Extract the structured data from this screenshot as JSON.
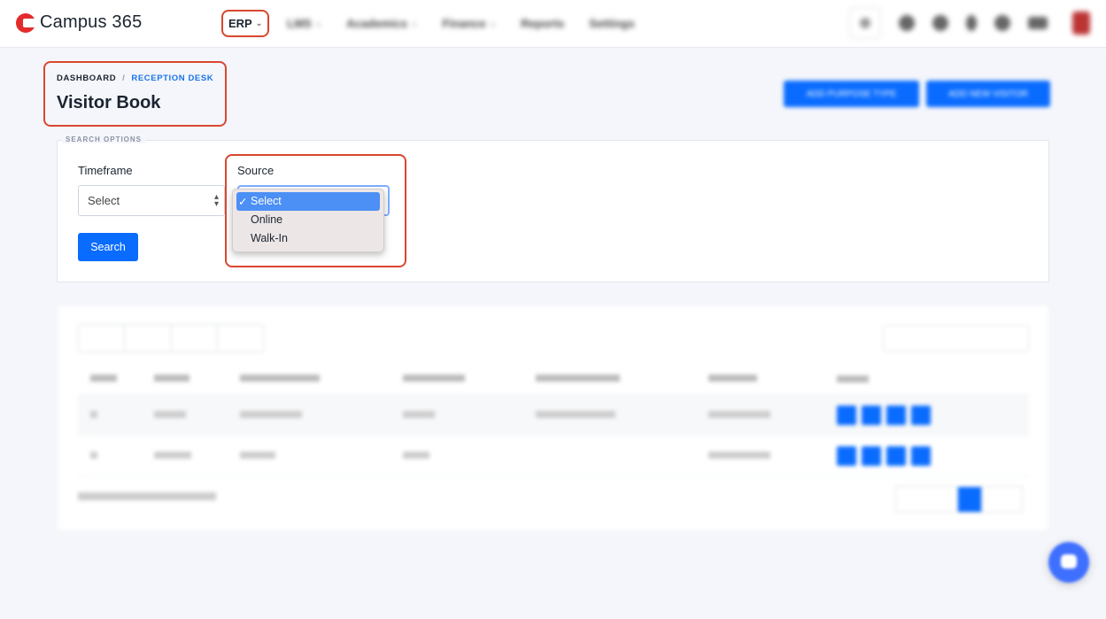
{
  "app": {
    "name": "Campus 365"
  },
  "nav": {
    "erp_label": "ERP",
    "menu": [
      "LMS",
      "Academics",
      "Finance",
      "Reports",
      "Settings"
    ]
  },
  "breadcrumb": {
    "home": "DASHBOARD",
    "separator": "/",
    "current": "RECEPTION DESK"
  },
  "page": {
    "title": "Visitor Book"
  },
  "header_buttons": [
    "ADD PURPOSE TYPE",
    "ADD NEW VISITOR"
  ],
  "search_options": {
    "legend": "SEARCH OPTIONS",
    "timeframe_label": "Timeframe",
    "timeframe_value": "Select",
    "source_label": "Source",
    "source_options": [
      "Select",
      "Online",
      "Walk-In"
    ],
    "source_selected_check": "✓",
    "search_button": "Search"
  },
  "colors": {
    "accent": "#0a6cff",
    "highlight": "#d9472f",
    "dropdown_selected": "#4c8ff5"
  }
}
